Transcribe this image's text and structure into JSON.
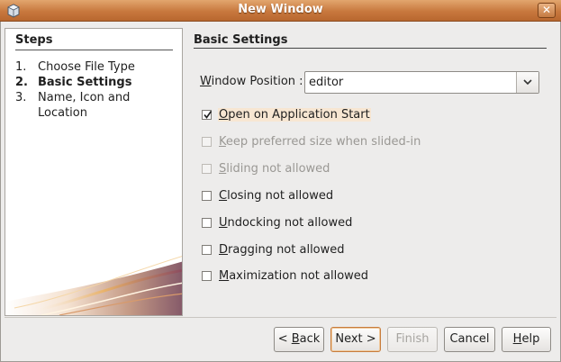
{
  "window": {
    "title": "New Window",
    "close_label": "✕"
  },
  "steps": {
    "title": "Steps",
    "items": [
      {
        "num": "1.",
        "label": "Choose File Type",
        "active": false
      },
      {
        "num": "2.",
        "label": "Basic Settings",
        "active": true
      },
      {
        "num": "3.",
        "label": "Name, Icon and Location",
        "active": false
      }
    ]
  },
  "panel": {
    "title": "Basic Settings",
    "position_label_first": "W",
    "position_label_rest": "indow Position :",
    "position_value": "editor"
  },
  "options": [
    {
      "mnemonic": "O",
      "rest": "pen on Application Start",
      "checked": true,
      "enabled": true
    },
    {
      "mnemonic": "K",
      "rest": "eep preferred size when slided-in",
      "checked": false,
      "enabled": false
    },
    {
      "mnemonic": "S",
      "rest": "liding not allowed",
      "checked": false,
      "enabled": false
    },
    {
      "mnemonic": "C",
      "rest": "losing not allowed",
      "checked": false,
      "enabled": true
    },
    {
      "mnemonic": "U",
      "rest": "ndocking not allowed",
      "checked": false,
      "enabled": true
    },
    {
      "mnemonic": "D",
      "rest": "ragging not allowed",
      "checked": false,
      "enabled": true
    },
    {
      "mnemonic": "M",
      "rest": "aximization not allowed",
      "checked": false,
      "enabled": true
    }
  ],
  "buttons": {
    "back_prefix": "< ",
    "back_mnemonic": "B",
    "back_rest": "ack",
    "next": "Next >",
    "finish": "Finish",
    "cancel": "Cancel",
    "help_mnemonic": "H",
    "help_rest": "elp"
  },
  "colors": {
    "titlebar": "#c8783e",
    "accent": "#f0c99d"
  }
}
